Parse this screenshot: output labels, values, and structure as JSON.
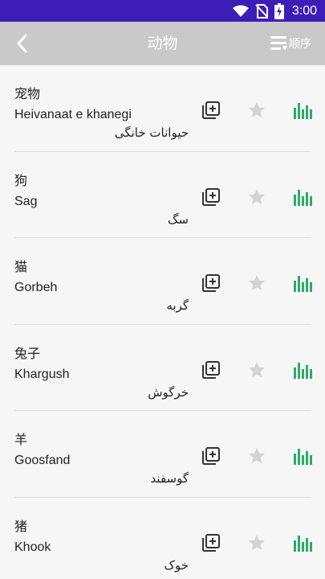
{
  "status_bar": {
    "time": "3:00",
    "icons": [
      "wifi-icon",
      "no-sim-icon",
      "battery-charging-icon"
    ],
    "color": "#3d1db8"
  },
  "app_bar": {
    "title": "动物",
    "back_icon": "chevron-left-icon",
    "order_icon": "sort-icon",
    "order_label": "顺序",
    "color": "#c9c9c9"
  },
  "accent_color": "#2eaa6a",
  "items": [
    {
      "chinese": "宠物",
      "latin": "Heivanaat e khanegi",
      "persian": "حیوانات خانگی"
    },
    {
      "chinese": "狗",
      "latin": "Sag",
      "persian": "سگ"
    },
    {
      "chinese": "猫",
      "latin": "Gorbeh",
      "persian": "گربه"
    },
    {
      "chinese": "兔子",
      "latin": "Khargush",
      "persian": "خرگوش"
    },
    {
      "chinese": "羊",
      "latin": "Goosfand",
      "persian": "گوسفند"
    },
    {
      "chinese": "猪",
      "latin": "Khook",
      "persian": "خوک"
    }
  ]
}
